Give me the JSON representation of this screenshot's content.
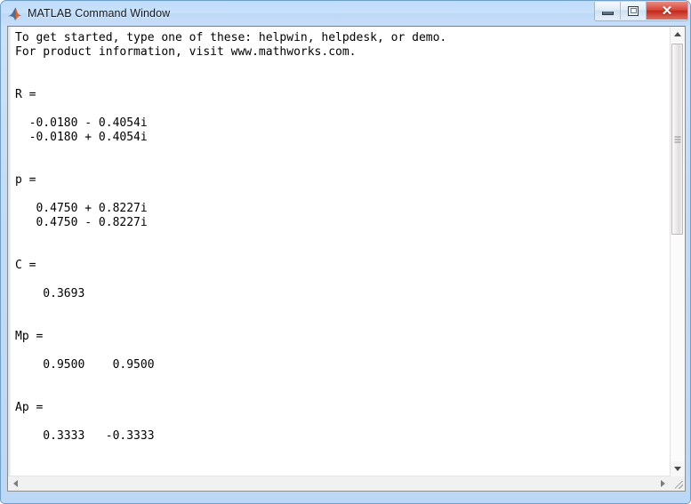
{
  "window": {
    "title": "MATLAB Command Window",
    "app_icon": "matlab-membrane-icon",
    "accent_color": "#c4ddf8",
    "frame_border_color": "#6f9fc9"
  },
  "titlebar_buttons": {
    "minimize": {
      "label": "–",
      "name": "minimize-button"
    },
    "restore": {
      "label": "□",
      "name": "restore-button"
    },
    "close": {
      "label": "✕",
      "name": "close-button",
      "color": "#c3291c"
    }
  },
  "console": {
    "text": "To get started, type one of these: helpwin, helpdesk, or demo.\nFor product information, visit www.mathworks.com.\n\n\nR =\n\n  -0.0180 - 0.4054i\n  -0.0180 + 0.4054i\n\n\np =\n\n   0.4750 + 0.8227i\n   0.4750 - 0.8227i\n\n\nC =\n\n    0.3693\n\n\nMp =\n\n    0.9500    0.9500\n\n\nAp =\n\n    0.3333   -0.3333\n",
    "lines": [
      "To get started, type one of these: helpwin, helpdesk, or demo.",
      "For product information, visit www.mathworks.com.",
      "",
      "",
      "R =",
      "",
      "  -0.0180 - 0.4054i",
      "  -0.0180 + 0.4054i",
      "",
      "",
      "p =",
      "",
      "   0.4750 + 0.8227i",
      "   0.4750 - 0.8227i",
      "",
      "",
      "C =",
      "",
      "    0.3693",
      "",
      "",
      "Mp =",
      "",
      "    0.9500    0.9500",
      "",
      "",
      "Ap =",
      "",
      "    0.3333   -0.3333"
    ],
    "variables": [
      {
        "name": "R",
        "values": [
          "-0.0180 - 0.4054i",
          "-0.0180 + 0.4054i"
        ]
      },
      {
        "name": "p",
        "values": [
          "0.4750 + 0.8227i",
          "0.4750 - 0.8227i"
        ]
      },
      {
        "name": "C",
        "values": [
          "0.3693"
        ]
      },
      {
        "name": "Mp",
        "values": [
          "0.9500",
          "0.9500"
        ]
      },
      {
        "name": "Ap",
        "values": [
          "0.3333",
          "-0.3333"
        ]
      }
    ],
    "startup_message": {
      "line1": "To get started, type one of these: helpwin, helpdesk, or demo.",
      "line2": "For product information, visit www.mathworks.com."
    }
  },
  "scrollbars": {
    "vertical": {
      "up_arrow": "▲",
      "down_arrow": "▼",
      "thumb_name": "vertical-scrollbar-thumb"
    },
    "horizontal": {
      "left_arrow": "◄",
      "right_arrow": "►",
      "thumb_name": "horizontal-scrollbar-thumb"
    }
  }
}
